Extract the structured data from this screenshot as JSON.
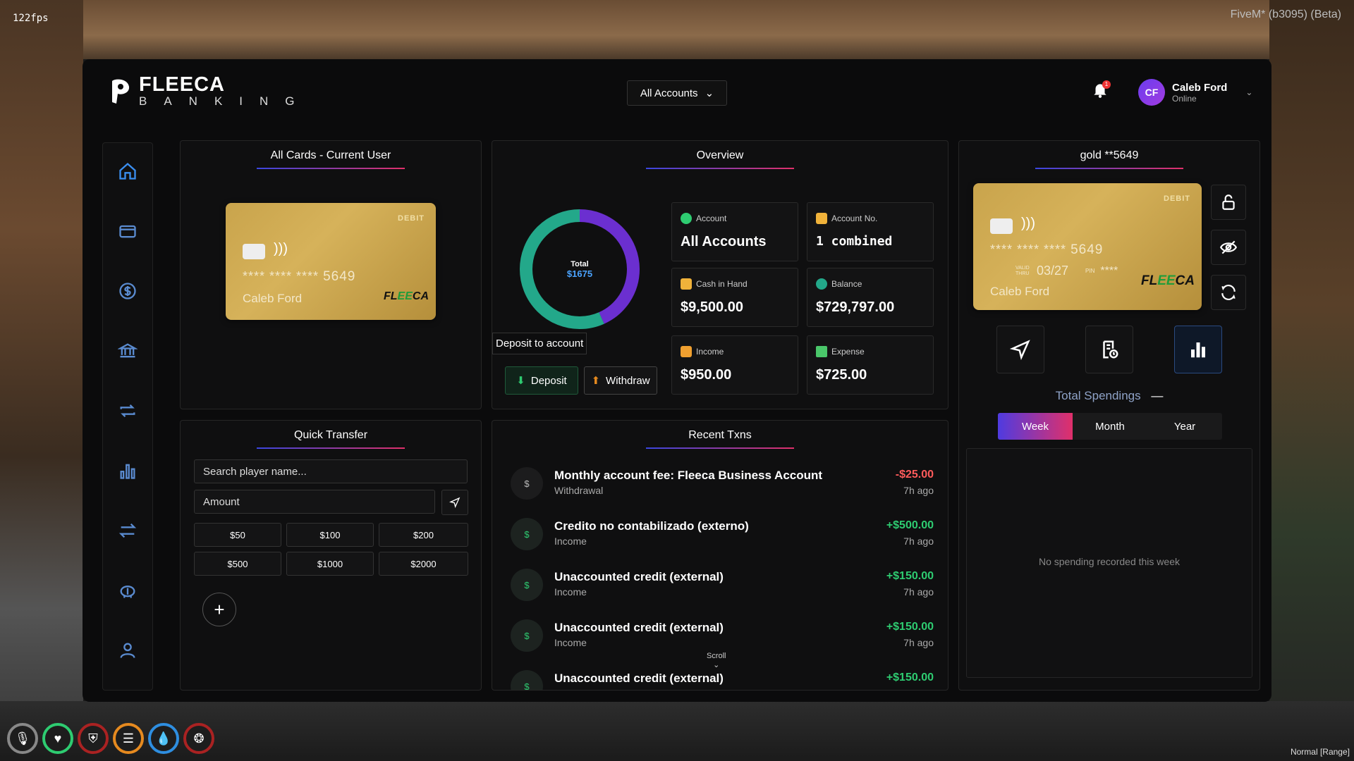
{
  "overlay": {
    "fps": "122fps",
    "build": "FiveM* (b3095) (Beta)",
    "mode": "Normal [Range]"
  },
  "header": {
    "brand_top": "FLEECA",
    "brand_bottom": "BANKING",
    "account_select": "All Accounts",
    "notifications": "1",
    "user": {
      "initials": "CF",
      "name": "Caleb Ford",
      "status": "Online"
    }
  },
  "sidebar": {
    "items": [
      "home-icon",
      "card-icon",
      "dollar-icon",
      "bank-icon",
      "repeat-icon",
      "stats-icon",
      "transfer-icon",
      "piggybank-icon",
      "user-icon"
    ]
  },
  "cards_panel": {
    "title": "All Cards - Current User",
    "card": {
      "type": "DEBIT",
      "number_mask": "**** **** ****",
      "last4": "5649",
      "holder": "Caleb Ford",
      "brand_a": "FL",
      "brand_b": "EE",
      "brand_c": "CA"
    }
  },
  "quick_transfer": {
    "title": "Quick Transfer",
    "search_placeholder": "Search player name...",
    "amount_placeholder": "Amount",
    "amounts": [
      "$50",
      "$100",
      "$200",
      "$500",
      "$1000",
      "$2000"
    ],
    "add_label": "+"
  },
  "overview": {
    "title": "Overview",
    "donut": {
      "label": "Total",
      "value": "$1675"
    },
    "tooltip": "Deposit to account",
    "deposit_label": "Deposit",
    "withdraw_label": "Withdraw",
    "stats": {
      "account": {
        "label": "Account",
        "value": "All Accounts"
      },
      "account_no": {
        "label": "Account No.",
        "value": "1 combined"
      },
      "cash": {
        "label": "Cash in Hand",
        "value": "$9,500.00"
      },
      "balance": {
        "label": "Balance",
        "value": "$729,797.00"
      },
      "income": {
        "label": "Income",
        "value": "$950.00"
      },
      "expense": {
        "label": "Expense",
        "value": "$725.00"
      }
    }
  },
  "recent": {
    "title": "Recent Txns",
    "scroll_label": "Scroll",
    "items": [
      {
        "title": "Monthly account fee: Fleeca Business Account",
        "type": "Withdrawal",
        "amount": "-$25.00",
        "time": "7h ago"
      },
      {
        "title": "Credito no contabilizado (externo)",
        "type": "Income",
        "amount": "+$500.00",
        "time": "7h ago"
      },
      {
        "title": "Unaccounted credit (external)",
        "type": "Income",
        "amount": "+$150.00",
        "time": "7h ago"
      },
      {
        "title": "Unaccounted credit (external)",
        "type": "Income",
        "amount": "+$150.00",
        "time": "7h ago"
      },
      {
        "title": "Unaccounted credit (external)",
        "type": "",
        "amount": "+$150.00",
        "time": ""
      }
    ]
  },
  "card_detail": {
    "title": "gold **5649",
    "card": {
      "type": "DEBIT",
      "number_mask": "**** **** ****",
      "last4": "5649",
      "valid_label": "VALID THRU",
      "expiry": "03/27",
      "pin_label": "PIN",
      "pin": "****",
      "holder": "Caleb Ford",
      "brand_a": "FL",
      "brand_b": "EE",
      "brand_c": "CA"
    },
    "spendings_title": "Total Spendings",
    "spendings_dash": "—",
    "tabs": [
      "Week",
      "Month",
      "Year"
    ],
    "empty_msg": "No spending recorded this week"
  },
  "colors": {
    "accent_blue": "#3a8ef0",
    "income_green": "#2ecc71",
    "expense_red": "#ff5b5b",
    "card_gold": "#c9a44c"
  }
}
